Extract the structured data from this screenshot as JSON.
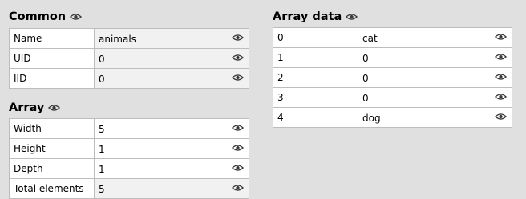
{
  "common": {
    "title": "Common",
    "rows": [
      {
        "label": "Name",
        "value": "animals"
      },
      {
        "label": "UID",
        "value": "0"
      },
      {
        "label": "IID",
        "value": "0"
      }
    ]
  },
  "array": {
    "title": "Array",
    "rows": [
      {
        "label": "Width",
        "value": "5"
      },
      {
        "label": "Height",
        "value": "1"
      },
      {
        "label": "Depth",
        "value": "1"
      },
      {
        "label": "Total elements",
        "value": "5"
      }
    ]
  },
  "array_data": {
    "title": "Array data",
    "rows": [
      {
        "label": "0",
        "value": "cat"
      },
      {
        "label": "1",
        "value": "0"
      },
      {
        "label": "2",
        "value": "0"
      },
      {
        "label": "3",
        "value": "0"
      },
      {
        "label": "4",
        "value": "dog"
      }
    ]
  },
  "icons": {
    "eye": "eye-icon"
  },
  "colors": {
    "background": "#e0e0e0",
    "cell_background": "#ffffff",
    "readonly_cell_background": "#f1f1f1",
    "border": "#bdbdbd"
  }
}
